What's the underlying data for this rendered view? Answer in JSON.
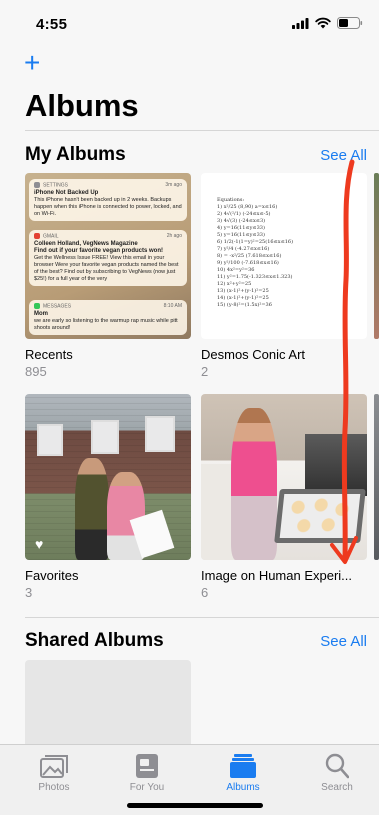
{
  "status": {
    "time": "4:55"
  },
  "header": {
    "add_glyph": "+",
    "title": "Albums"
  },
  "my_albums": {
    "title": "My Albums",
    "see_all": "See All",
    "albums": [
      {
        "name": "Recents",
        "count": "895"
      },
      {
        "name": "Desmos Conic Art",
        "count": "2"
      },
      {
        "name": "Favorites",
        "count": "3"
      },
      {
        "name": "Image on Human Experi...",
        "count": "6"
      }
    ]
  },
  "recents_preview": {
    "notif1": {
      "app": "SETTINGS",
      "time": "3m ago",
      "title": "iPhone Not Backed Up",
      "body": "This iPhone hasn't been backed up in 2 weeks. Backups happen when this iPhone is connected to power, locked, and on Wi-Fi."
    },
    "notif2": {
      "app": "GMAIL",
      "time": "2h ago",
      "title": "Colleen Holland, VegNews Magazine",
      "subtitle": "Find out if your favorite vegan products won!",
      "body": "Get the Wellness Issue FREE! View this email in your browser Were your favorite vegan products named the best of the best? Find out by subscribing to VegNews (now just $25!) for a full year of the very"
    },
    "notif3": {
      "app": "MESSAGES",
      "time": "8:10 AM",
      "title": "Mom",
      "body": "we are early so listening to the warmup rap music while pitt shoots around!"
    }
  },
  "desmos_preview": {
    "text": "Equations:\n1) x²/25 (8,90) a=x≤16)\n2) 4√(²/1) (-24≤x≤-5)\n3) 4√(3) (-24≤x≤3)\n4) y=16(11≤y≤33)\n5) y=16(11≤y≤33)\n6) 1/2(-1(1=y)²=25(16≤x≤16)\n7) y²/4 (-4.27≤x≤16)\n8) = -x²/25 (7.618≤x≤16)\n9) y²/100 (-7.618≤x≤16)\n10) 4x²=y²=36\n11) y²=1.75(-1.323≤x≤1.323)\n12) x²+y²=25\n13) (x-1)²+(y-1)²=25\n14) (x-1)²+(y-1)²=25\n15) (y-8)²=(1.5x)²=36"
  },
  "shared_albums": {
    "title": "Shared Albums",
    "see_all": "See All"
  },
  "tabs": [
    {
      "label": "Photos"
    },
    {
      "label": "For You"
    },
    {
      "label": "Albums"
    },
    {
      "label": "Search"
    }
  ],
  "colors": {
    "accent": "#1a7cf0",
    "annotation": "#ee3a1f",
    "secondary_text": "#8e8e93"
  },
  "icons": [
    "signal-icon",
    "wifi-icon",
    "battery-icon",
    "plus-icon",
    "heart-icon",
    "photos-tab-icon",
    "for-you-tab-icon",
    "albums-tab-icon",
    "search-tab-icon"
  ]
}
